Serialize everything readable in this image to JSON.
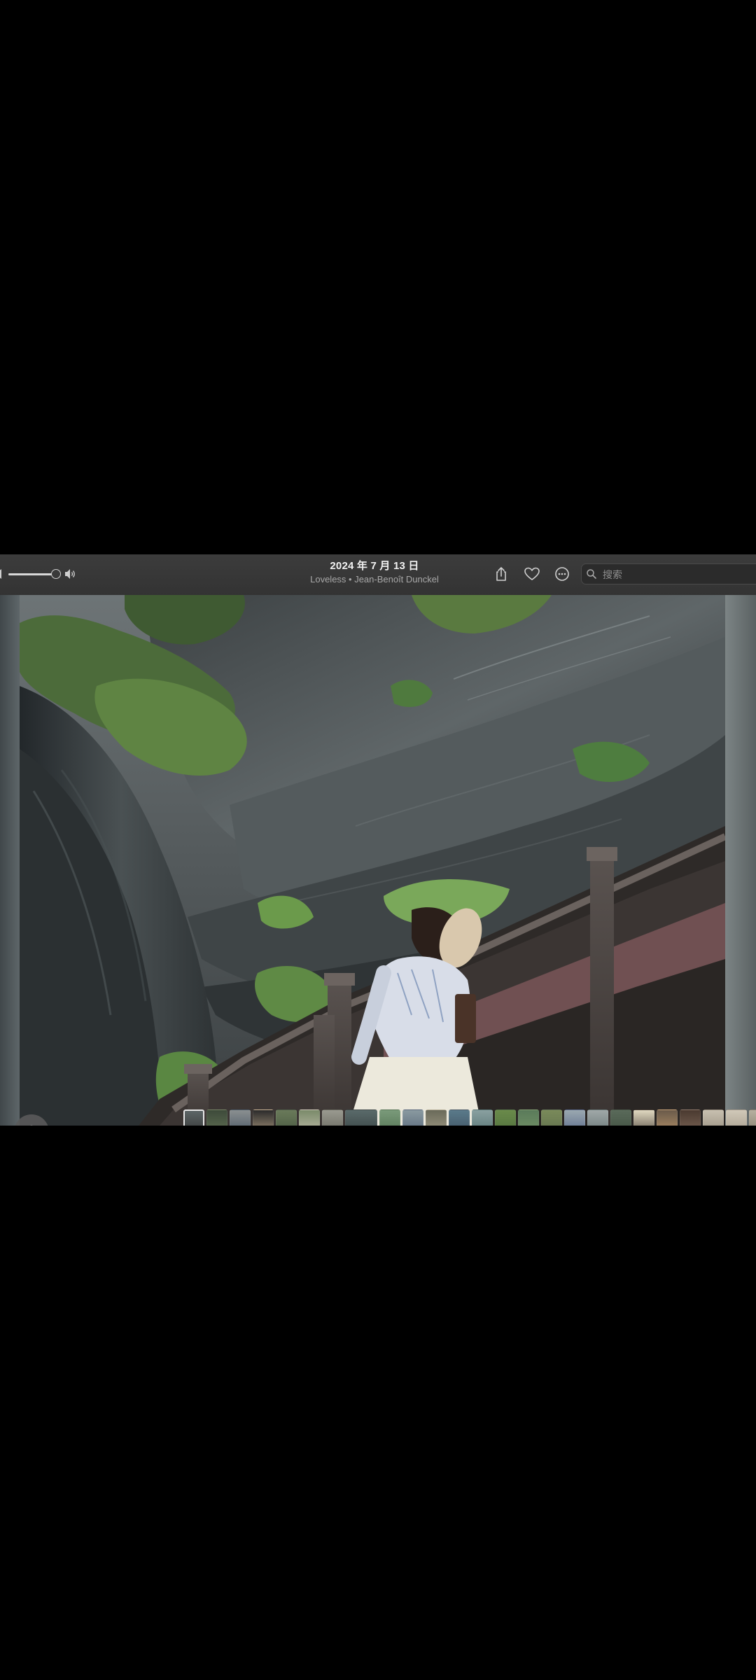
{
  "toolbar": {
    "title": "2024 年 7 月 13 日",
    "subtitle": "Loveless • Jean-Benoît Dunckel",
    "volume_level": 1.0,
    "search_placeholder": "搜索"
  },
  "icons": {
    "volume_low": "speaker-low-icon",
    "volume_high": "speaker-high-icon",
    "share": "share-icon",
    "favorite": "heart-icon",
    "more": "ellipsis-circle-icon",
    "search": "magnifier-icon",
    "filters": "filters-icon"
  },
  "filmstrip": {
    "thumbnail_count": 26,
    "selected_index": 0
  },
  "colors": {
    "toolbar_bg": "#3a3a3a",
    "title_text": "#f2f2f2",
    "subtitle_text": "#a8a8a8"
  }
}
